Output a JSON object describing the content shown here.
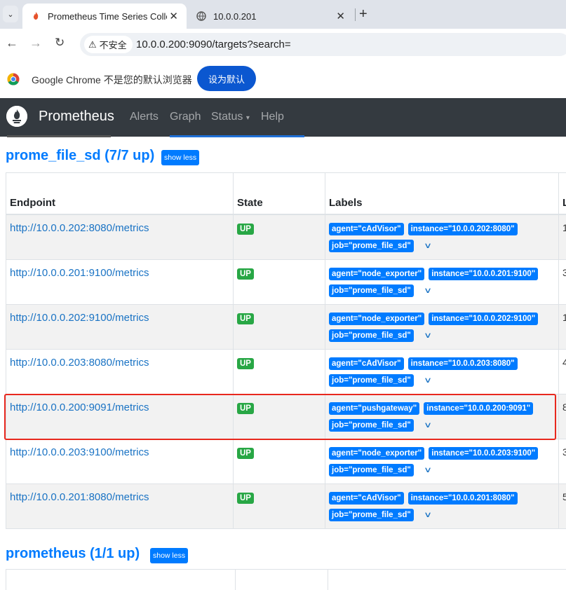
{
  "browser": {
    "tabs": [
      {
        "title": "Prometheus Time Series Colle",
        "active": true,
        "icon": "prometheus-favicon"
      },
      {
        "title": "10.0.0.201",
        "active": false,
        "icon": "globe-icon"
      }
    ],
    "security_label": "不安全",
    "url": "10.0.0.200:9090/targets?search=",
    "infobar_text": "Google Chrome 不是您的默认浏览器",
    "set_default_label": "设为默认"
  },
  "navbar": {
    "brand": "Prometheus",
    "links": [
      "Alerts",
      "Graph",
      "Status",
      "Help"
    ],
    "status_caret": "▾"
  },
  "section1": {
    "title": "prome_file_sd (7/7 up)",
    "toggle_label": "show less",
    "headers": [
      "Endpoint",
      "State",
      "Labels",
      "L"
    ],
    "rows": [
      {
        "endpoint": "http://10.0.0.202:8080/metrics",
        "state": "UP",
        "labels": [
          "agent=\"cAdVisor\"",
          "instance=\"10.0.0.202:8080\"",
          "job=\"prome_file_sd\""
        ],
        "last": "1"
      },
      {
        "endpoint": "http://10.0.0.201:9100/metrics",
        "state": "UP",
        "labels": [
          "agent=\"node_exporter\"",
          "instance=\"10.0.0.201:9100\"",
          "job=\"prome_file_sd\""
        ],
        "last": "3"
      },
      {
        "endpoint": "http://10.0.0.202:9100/metrics",
        "state": "UP",
        "labels": [
          "agent=\"node_exporter\"",
          "instance=\"10.0.0.202:9100\"",
          "job=\"prome_file_sd\""
        ],
        "last": "1"
      },
      {
        "endpoint": "http://10.0.0.203:8080/metrics",
        "state": "UP",
        "labels": [
          "agent=\"cAdVisor\"",
          "instance=\"10.0.0.203:8080\"",
          "job=\"prome_file_sd\""
        ],
        "last": "4"
      },
      {
        "endpoint": "http://10.0.0.200:9091/metrics",
        "state": "UP",
        "labels": [
          "agent=\"pushgateway\"",
          "instance=\"10.0.0.200:9091\"",
          "job=\"prome_file_sd\""
        ],
        "last": "8"
      },
      {
        "endpoint": "http://10.0.0.203:9100/metrics",
        "state": "UP",
        "labels": [
          "agent=\"node_exporter\"",
          "instance=\"10.0.0.203:9100\"",
          "job=\"prome_file_sd\""
        ],
        "last": "3"
      },
      {
        "endpoint": "http://10.0.0.201:8080/metrics",
        "state": "UP",
        "labels": [
          "agent=\"cAdVisor\"",
          "instance=\"10.0.0.201:8080\"",
          "job=\"prome_file_sd\""
        ],
        "last": "5"
      }
    ]
  },
  "section2": {
    "title": "prometheus (1/1 up)",
    "toggle_label": "show less"
  },
  "colors": {
    "primary": "#007bff",
    "success": "#28a745",
    "navbar_bg": "#343a40",
    "highlight_border": "#e8281e"
  }
}
